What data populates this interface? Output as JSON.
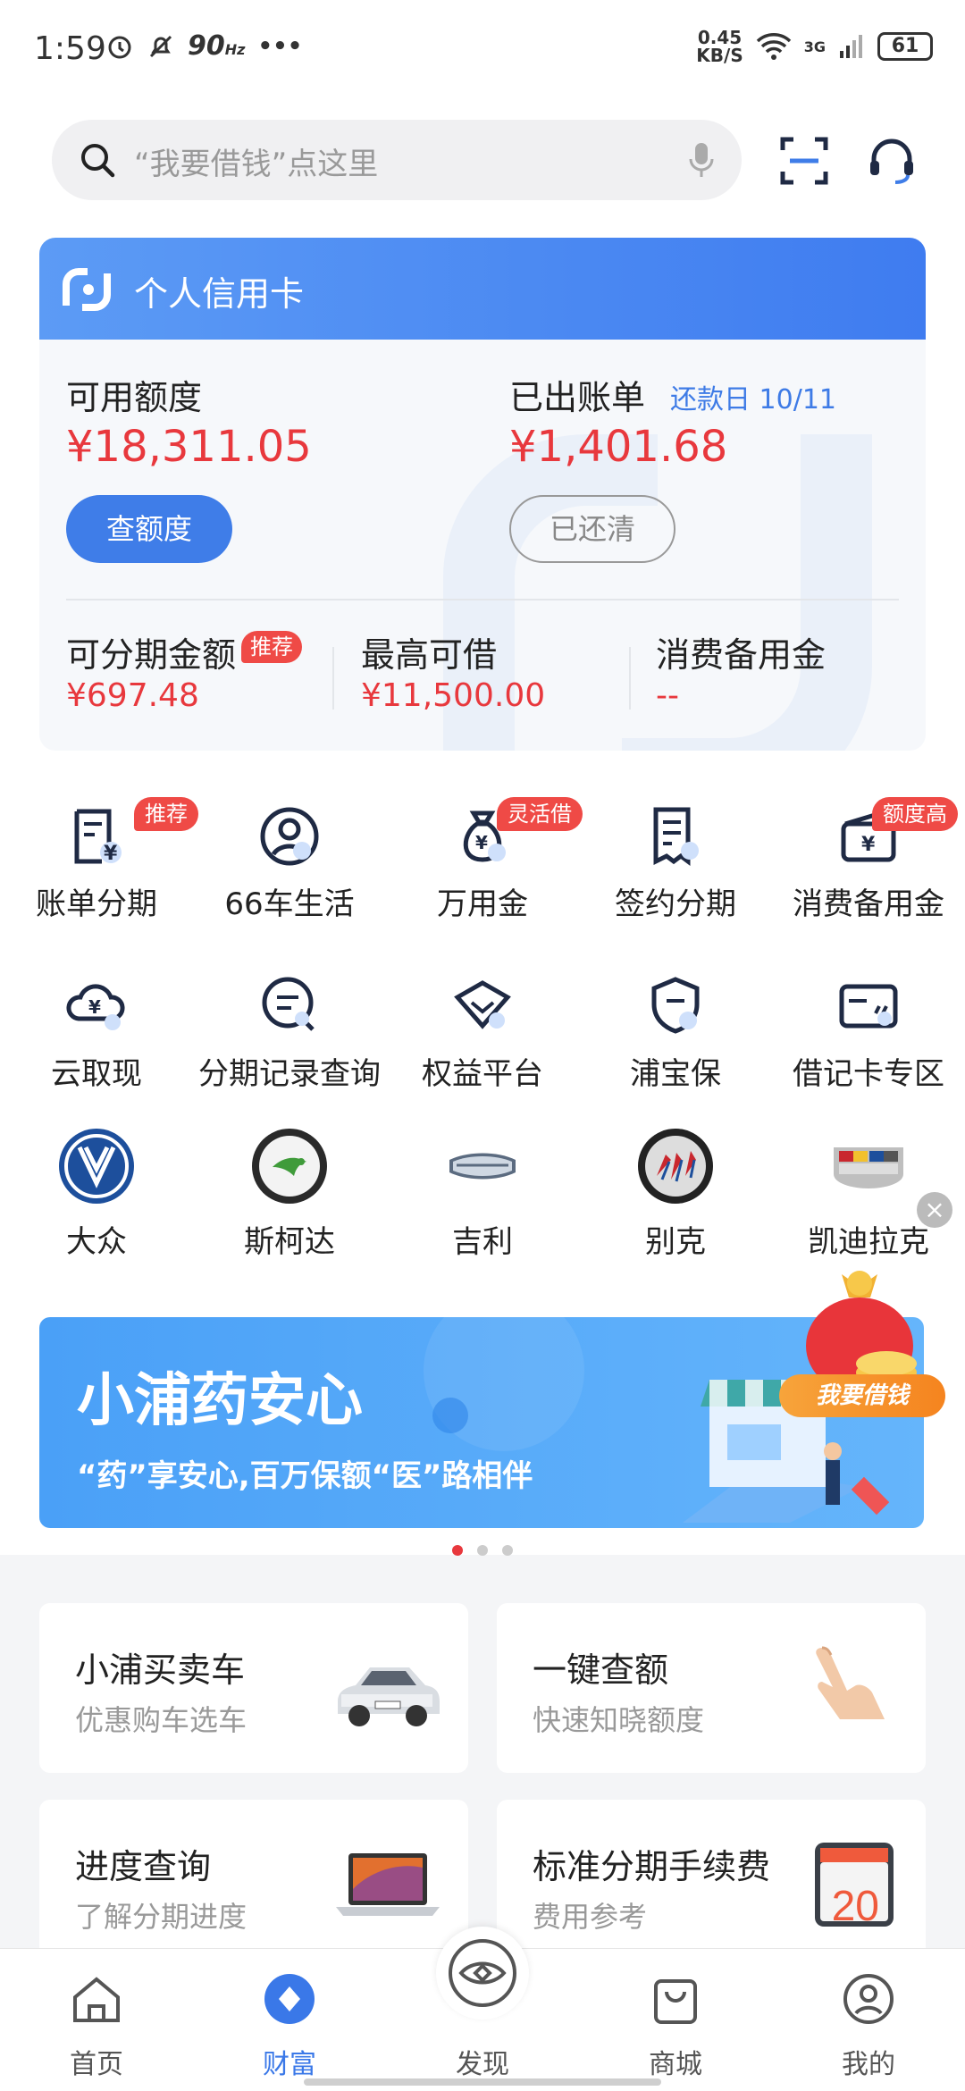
{
  "status_bar": {
    "time": "1:59",
    "refresh": "90",
    "refresh_unit": "Hz",
    "more": "•••",
    "speed_value": "0.45",
    "speed_unit": "KB/S",
    "network": "3G",
    "battery": "61"
  },
  "search": {
    "placeholder": "“我要借钱”点这里"
  },
  "card": {
    "title": "个人信用卡",
    "available_label": "可用额度",
    "available_amount": "¥18,311.05",
    "bill_label": "已出账单",
    "due_label": "还款日 10/11",
    "bill_amount": "¥1,401.68",
    "check_button": "查额度",
    "paid_button": "已还清",
    "installment_label": "可分期金额",
    "installment_badge": "推荐",
    "installment_amount": "¥697.48",
    "max_borrow_label": "最高可借",
    "max_borrow_amount": "¥11,500.00",
    "reserve_label": "消费备用金",
    "reserve_amount": "--"
  },
  "services": [
    {
      "label": "账单分期",
      "badge": "推荐",
      "icon": "bill-installment-icon"
    },
    {
      "label": "66车生活",
      "badge": "",
      "icon": "user-circle-icon"
    },
    {
      "label": "万用金",
      "badge": "灵活借",
      "icon": "money-bag-icon"
    },
    {
      "label": "签约分期",
      "badge": "",
      "icon": "contract-icon"
    },
    {
      "label": "消费备用金",
      "badge": "额度高",
      "icon": "wallet-icon"
    },
    {
      "label": "云取现",
      "badge": "",
      "icon": "cloud-cash-icon"
    },
    {
      "label": "分期记录查询",
      "badge": "",
      "icon": "record-search-icon"
    },
    {
      "label": "权益平台",
      "badge": "",
      "icon": "diamond-icon"
    },
    {
      "label": "浦宝保",
      "badge": "",
      "icon": "shield-icon"
    },
    {
      "label": "借记卡专区",
      "badge": "",
      "icon": "debit-card-icon"
    }
  ],
  "brands": [
    {
      "label": "大众",
      "icon": "volkswagen-logo-icon"
    },
    {
      "label": "斯柯达",
      "icon": "skoda-logo-icon"
    },
    {
      "label": "吉利",
      "icon": "geely-logo-icon"
    },
    {
      "label": "别克",
      "icon": "buick-logo-icon"
    },
    {
      "label": "凯迪拉克",
      "icon": "cadillac-logo-icon"
    }
  ],
  "banner": {
    "title": "小浦药安心",
    "subtitle": "“药”享安心,百万保额“医”路相伴",
    "float_label": "我要借钱"
  },
  "features": [
    {
      "title": "小浦买卖车",
      "subtitle": "优惠购车选车",
      "icon": "car-icon"
    },
    {
      "title": "一键查额",
      "subtitle": "快速知晓额度",
      "icon": "hand-tap-icon"
    },
    {
      "title": "进度查询",
      "subtitle": "了解分期进度",
      "icon": "laptop-icon"
    },
    {
      "title": "标准分期手续费",
      "subtitle": "费用参考",
      "icon": "calendar-icon",
      "calendar_day": "20"
    }
  ],
  "nav": [
    {
      "label": "首页",
      "icon": "home-icon"
    },
    {
      "label": "财富",
      "icon": "wealth-icon",
      "active": true
    },
    {
      "label": "发现",
      "icon": "discover-eye-icon"
    },
    {
      "label": "商城",
      "icon": "shopping-bag-icon"
    },
    {
      "label": "我的",
      "icon": "profile-icon"
    }
  ],
  "colors": {
    "accent_blue": "#3f7de8",
    "amount_red": "#e8383d",
    "badge_red": "#ef4a46"
  }
}
